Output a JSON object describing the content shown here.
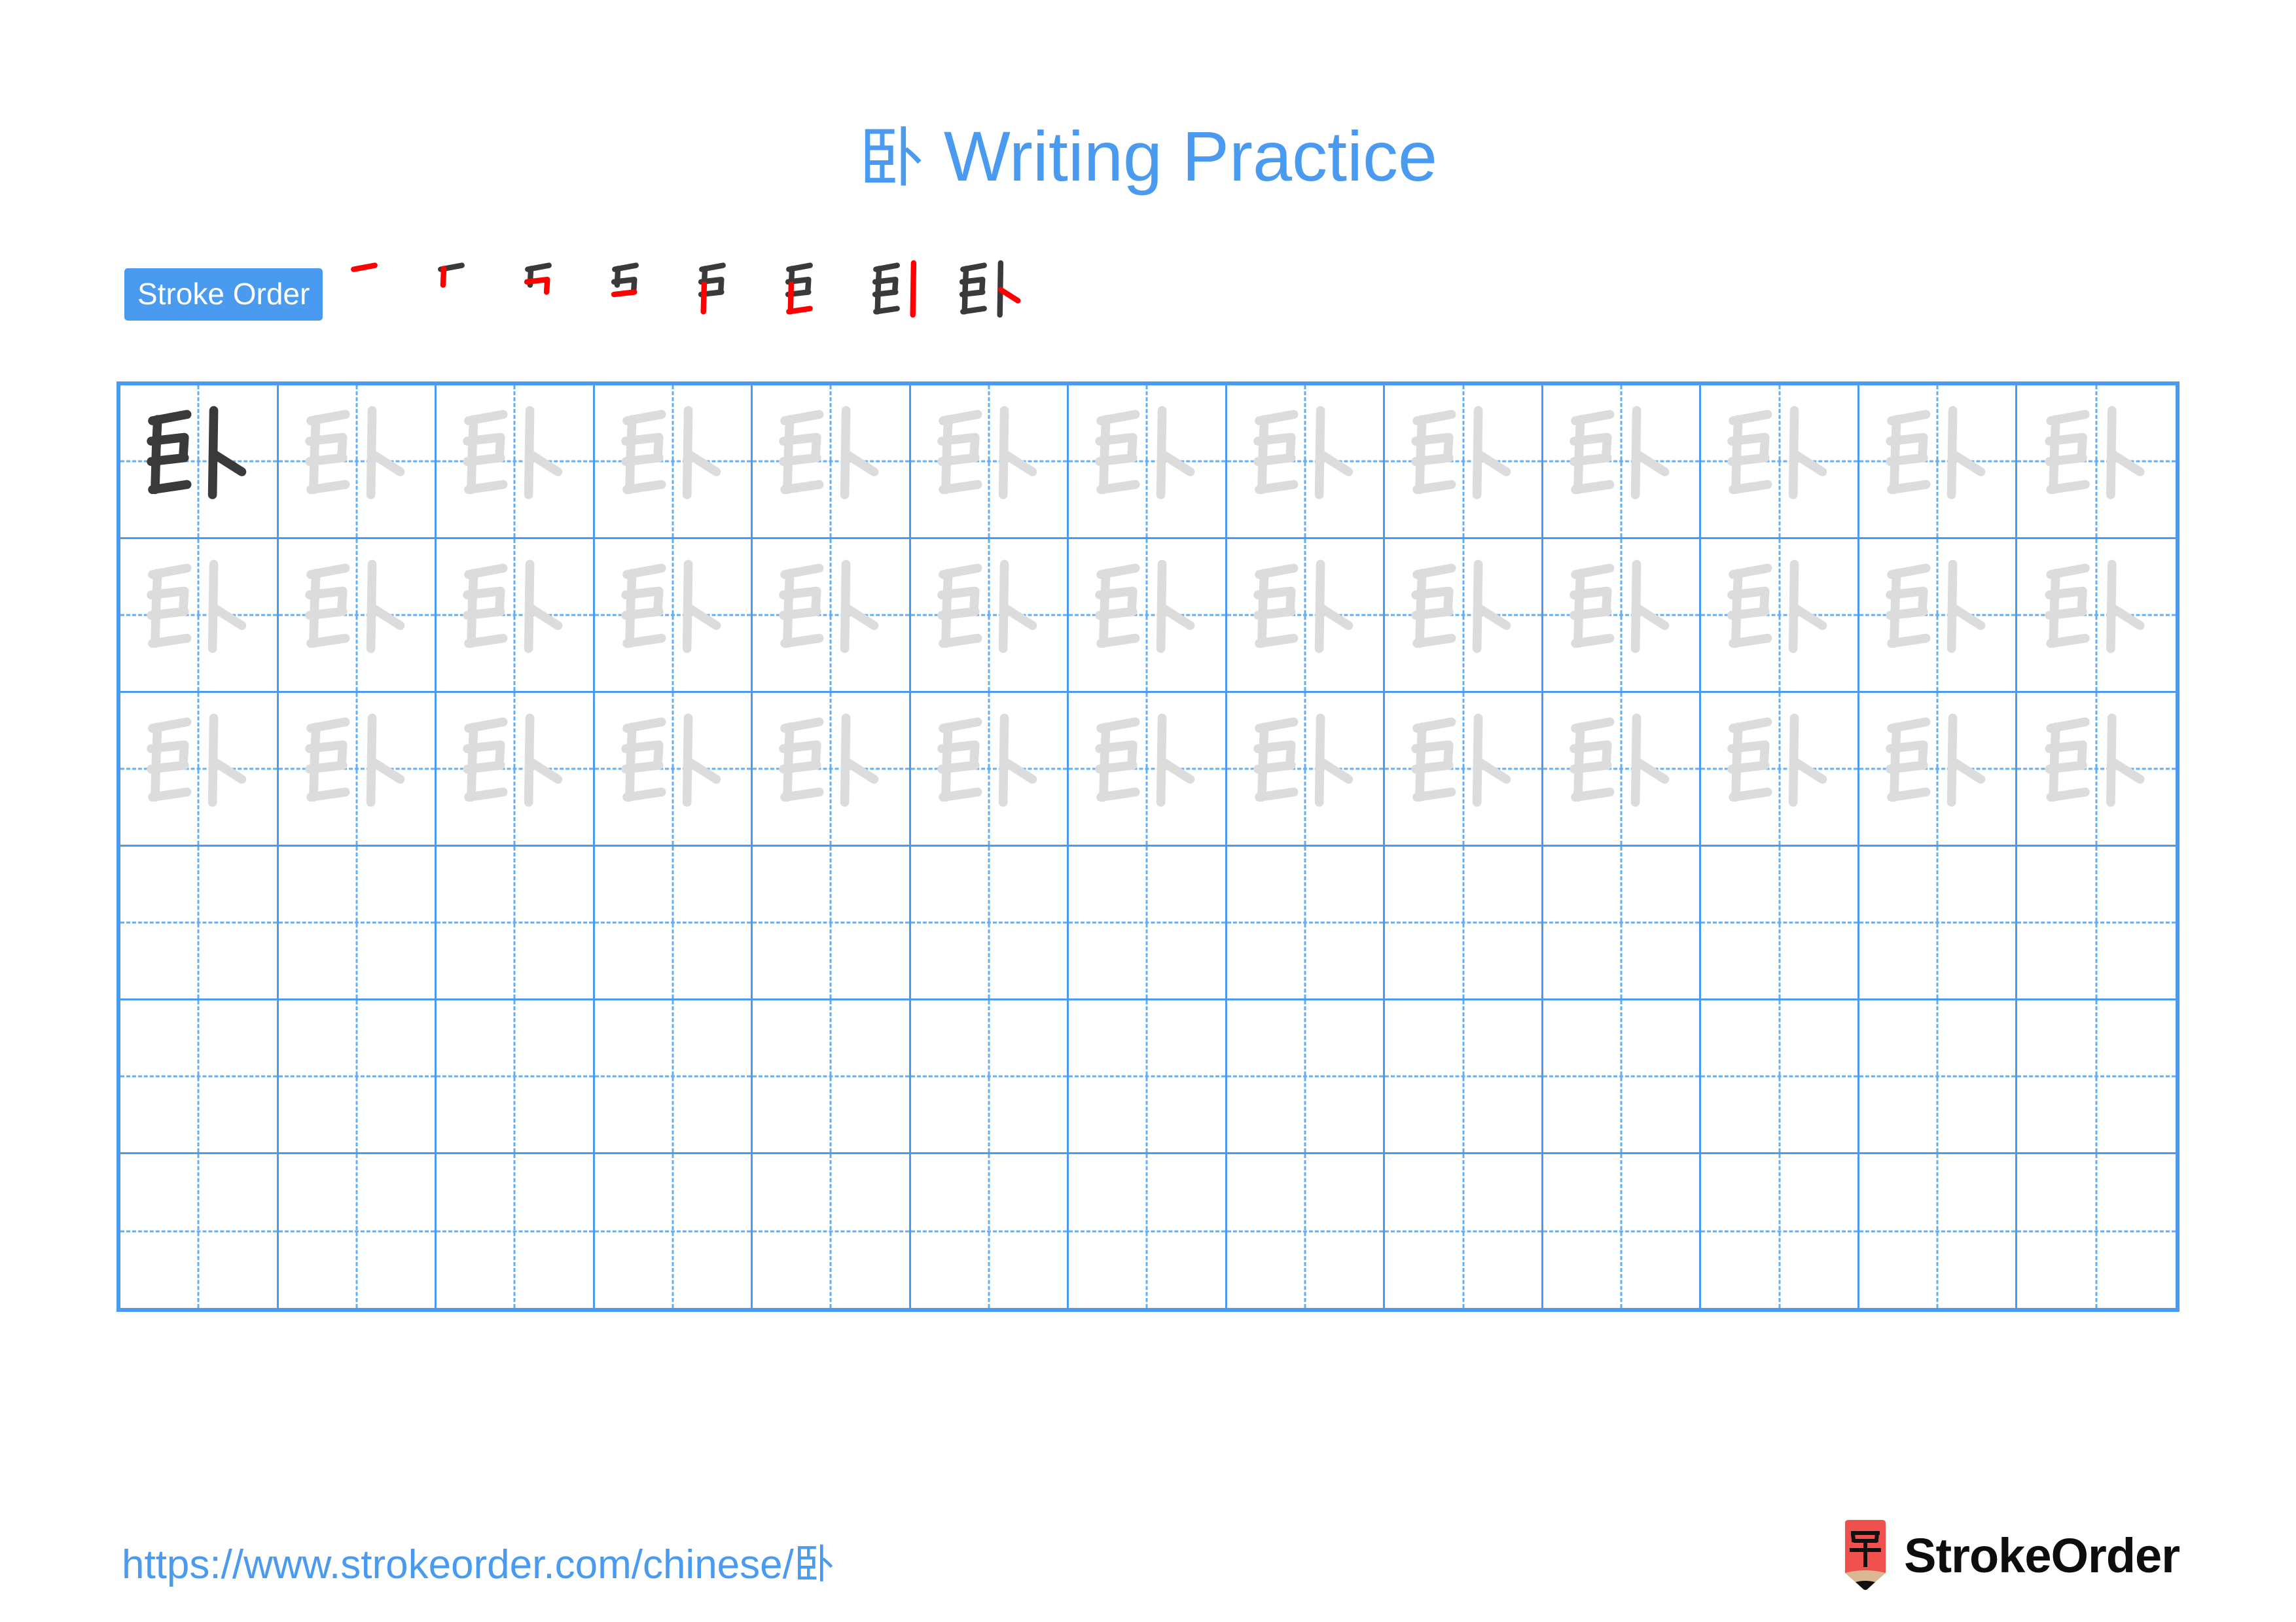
{
  "page": {
    "character": "卧",
    "title_suffix": " Writing Practice",
    "title_full": "卧 Writing Practice",
    "background_color": "#ffffff",
    "accent_color": "#4a9bf0",
    "grid_line_color": "#4a9bf0",
    "guide_line_color": "#63aef5",
    "example_ink_color": "#3a3a3a",
    "trace_ink_color": "#dcdcdc",
    "new_stroke_color": "#ff0000",
    "done_stroke_color": "#3a3a3a"
  },
  "stroke_order": {
    "badge_label": "Stroke Order",
    "total_strokes": 8,
    "steps": [
      {
        "index": 1,
        "name": "stroke-step-1",
        "new_stroke": "héng"
      },
      {
        "index": 2,
        "name": "stroke-step-2",
        "new_stroke": "shù"
      },
      {
        "index": 3,
        "name": "stroke-step-3",
        "new_stroke": "héng-zhé"
      },
      {
        "index": 4,
        "name": "stroke-step-4",
        "new_stroke": "héng"
      },
      {
        "index": 5,
        "name": "stroke-step-5",
        "new_stroke": "shù"
      },
      {
        "index": 6,
        "name": "stroke-step-6",
        "new_stroke": "héng"
      },
      {
        "index": 7,
        "name": "stroke-step-7",
        "new_stroke": "shù"
      },
      {
        "index": 8,
        "name": "stroke-step-8",
        "new_stroke": "diǎn"
      }
    ]
  },
  "practice_grid": {
    "columns": 13,
    "rows": 6,
    "cells": [
      [
        "example",
        "trace",
        "trace",
        "trace",
        "trace",
        "trace",
        "trace",
        "trace",
        "trace",
        "trace",
        "trace",
        "trace",
        "trace"
      ],
      [
        "trace",
        "trace",
        "trace",
        "trace",
        "trace",
        "trace",
        "trace",
        "trace",
        "trace",
        "trace",
        "trace",
        "trace",
        "trace"
      ],
      [
        "trace",
        "trace",
        "trace",
        "trace",
        "trace",
        "trace",
        "trace",
        "trace",
        "trace",
        "trace",
        "trace",
        "trace",
        "trace"
      ],
      [
        "empty",
        "empty",
        "empty",
        "empty",
        "empty",
        "empty",
        "empty",
        "empty",
        "empty",
        "empty",
        "empty",
        "empty",
        "empty"
      ],
      [
        "empty",
        "empty",
        "empty",
        "empty",
        "empty",
        "empty",
        "empty",
        "empty",
        "empty",
        "empty",
        "empty",
        "empty",
        "empty"
      ],
      [
        "empty",
        "empty",
        "empty",
        "empty",
        "empty",
        "empty",
        "empty",
        "empty",
        "empty",
        "empty",
        "empty",
        "empty",
        "empty"
      ]
    ]
  },
  "footer": {
    "url": "https://www.strokeorder.com/chinese/卧",
    "brand_name": "StrokeOrder",
    "logo_character": "字",
    "logo_body_color": "#f0514f",
    "logo_tip_color": "#dbb894",
    "logo_point_color": "#111111"
  }
}
